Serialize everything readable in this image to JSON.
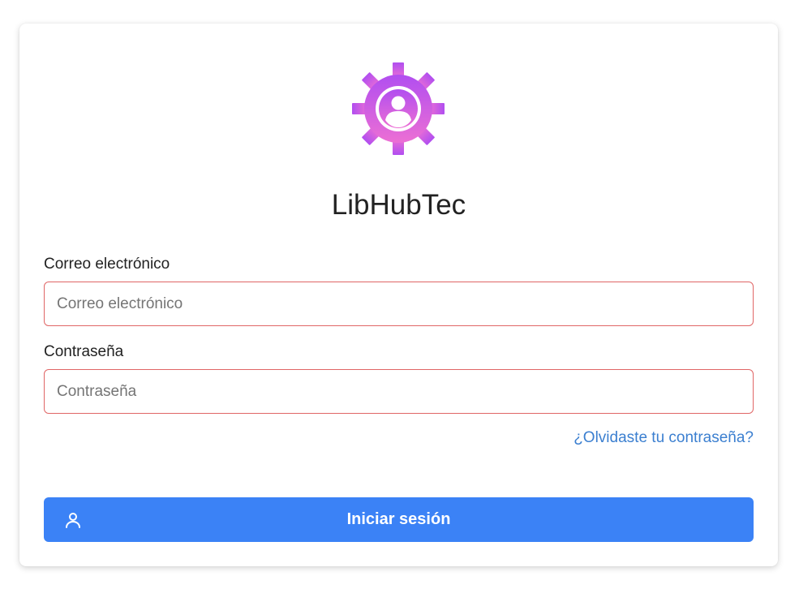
{
  "app": {
    "title": "LibHubTec",
    "logo_icon": "gear-user-icon",
    "logo_gradient": [
      "#b14ef0",
      "#e96ad6"
    ]
  },
  "form": {
    "email_label": "Correo electrónico",
    "email_placeholder": "Correo electrónico",
    "email_value": "",
    "password_label": "Contraseña",
    "password_placeholder": "Contraseña",
    "password_value": "",
    "forgot_link": "¿Olvidaste tu contraseña?",
    "submit_label": "Iniciar sesión",
    "submit_icon": "user-icon"
  },
  "colors": {
    "accent": "#3b82f6",
    "link": "#3b7fd0",
    "input_border_error": "#e06666"
  }
}
